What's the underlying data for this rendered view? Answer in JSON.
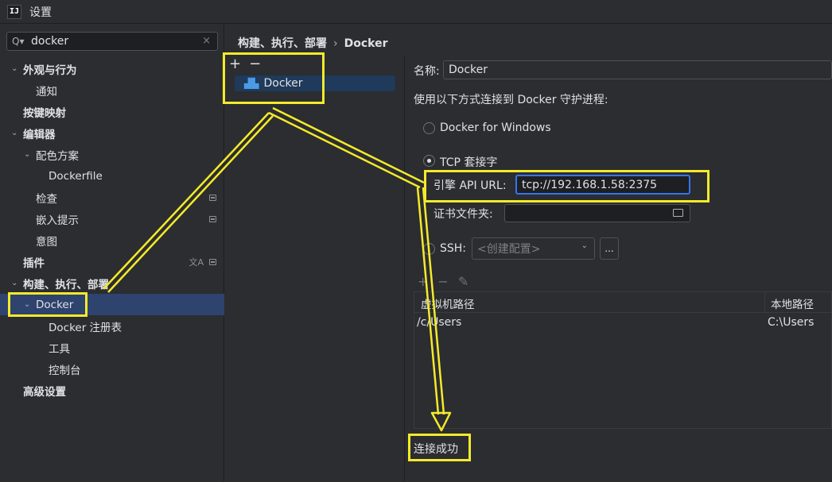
{
  "window": {
    "title": "设置",
    "logo_text": "IJ"
  },
  "search": {
    "value": "docker",
    "clear": "×"
  },
  "tree": [
    {
      "label": "外观与行为",
      "bold": true,
      "arrow": "⌄",
      "level": 0
    },
    {
      "label": "通知",
      "bold": false,
      "arrow": "",
      "level": 2
    },
    {
      "label": "按键映射",
      "bold": true,
      "arrow": "",
      "level": 0
    },
    {
      "label": "编辑器",
      "bold": true,
      "arrow": "⌄",
      "level": 0
    },
    {
      "label": "配色方案",
      "bold": false,
      "arrow": "⌄",
      "level": 1
    },
    {
      "label": "Dockerfile",
      "bold": false,
      "arrow": "",
      "level": 3
    },
    {
      "label": "检查",
      "bold": false,
      "arrow": "",
      "level": 2
    },
    {
      "label": "嵌入提示",
      "bold": false,
      "arrow": "",
      "level": 2
    },
    {
      "label": "意图",
      "bold": false,
      "arrow": "",
      "level": 2
    },
    {
      "label": "插件",
      "bold": true,
      "arrow": "",
      "level": 0
    },
    {
      "label": "构建、执行、部署",
      "bold": true,
      "arrow": "⌄",
      "level": 0
    },
    {
      "label": "Docker",
      "bold": false,
      "arrow": "⌄",
      "level": 1
    },
    {
      "label": "Docker 注册表",
      "bold": false,
      "arrow": "",
      "level": 3
    },
    {
      "label": "工具",
      "bold": false,
      "arrow": "",
      "level": 3
    },
    {
      "label": "控制台",
      "bold": false,
      "arrow": "",
      "level": 3
    },
    {
      "label": "高级设置",
      "bold": true,
      "arrow": "",
      "level": 0
    }
  ],
  "breadcrumb": {
    "parent": "构建、执行、部署",
    "separator": "›",
    "current": "Docker"
  },
  "middle": {
    "add": "+",
    "remove": "−",
    "item": "Docker"
  },
  "form": {
    "name_label": "名称:",
    "name_value": "Docker",
    "connect_label": "使用以下方式连接到 Docker 守护进程:",
    "opt_windows": "Docker for Windows",
    "opt_tcp": "TCP 套接字",
    "api_url_label": "引擎 API URL:",
    "api_url_value": "tcp://192.168.1.58:2375",
    "cert_label": "证书文件夹:",
    "opt_ssh": "SSH:",
    "ssh_placeholder": "<创建配置>",
    "ssh_more": "..."
  },
  "table": {
    "toolbar": {
      "add": "+",
      "remove": "−",
      "edit": "✎"
    },
    "headers": [
      "虚拟机路径",
      "本地路径"
    ],
    "rows": [
      [
        "/c/Users",
        "C:\\Users"
      ]
    ]
  },
  "status": "连接成功",
  "colors": {
    "highlight": "#f5ea2a",
    "selection": "#2e436e",
    "accent": "#3574f0"
  }
}
